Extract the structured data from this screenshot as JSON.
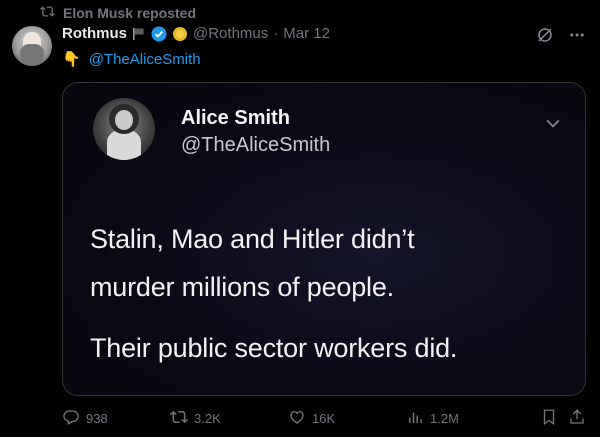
{
  "repost": {
    "label": "Elon Musk reposted",
    "icon": "repost-icon"
  },
  "post": {
    "author_name": "Rothmus",
    "handle": "@Rothmus",
    "separator": "·",
    "date": "Mar 12",
    "emoji": "👇",
    "mention": "@TheAliceSmith",
    "badges": [
      "flag-icon",
      "verified-icon",
      "gold-badge-icon"
    ]
  },
  "quote": {
    "author_name": "Alice Smith",
    "handle": "@TheAliceSmith",
    "lines": [
      "Stalin, Mao and Hitler didn’t",
      "murder millions of people.",
      "Their public sector workers did."
    ]
  },
  "actions": {
    "replies": "938",
    "reposts": "3.2K",
    "likes": "16K",
    "views": "1.2M"
  },
  "colors": {
    "background": "#000000",
    "muted": "#71767b",
    "accent": "#1d9bf0",
    "verified": "#1d9bf0",
    "gold": "#e8b923"
  }
}
